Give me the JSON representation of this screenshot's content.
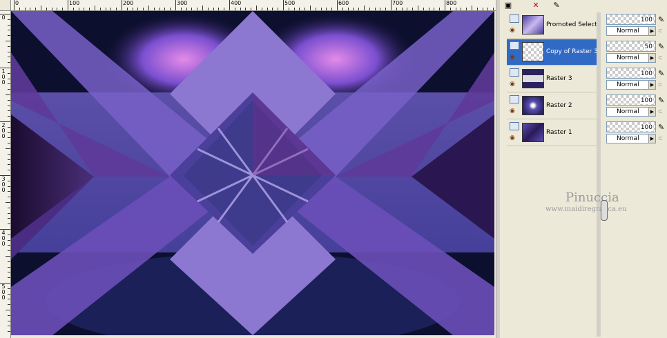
{
  "ruler": {
    "horizontal_labels": [
      "0",
      "100",
      "200",
      "300",
      "400",
      "500",
      "600",
      "700",
      "800"
    ],
    "vertical_labels": [
      "0",
      "1\n0\n0",
      "2\n0\n0",
      "3\n0\n0",
      "4\n0\n0",
      "5\n0\n0"
    ]
  },
  "toolbar": {
    "icons": [
      "new-layer-icon",
      "delete-layer-icon",
      "edit-icon"
    ]
  },
  "layers": [
    {
      "name": "Promoted Selection",
      "selected": false,
      "opacity": "100",
      "blend": "Normal"
    },
    {
      "name": "Copy of Raster 3",
      "selected": true,
      "opacity": "50",
      "blend": "Normal"
    },
    {
      "name": "Raster 3",
      "selected": false,
      "opacity": "100",
      "blend": "Normal"
    },
    {
      "name": "Raster 2",
      "selected": false,
      "opacity": "100",
      "blend": "Normal"
    },
    {
      "name": "Raster 1",
      "selected": false,
      "opacity": "100",
      "blend": "Normal"
    }
  ],
  "watermark": {
    "line1": "Pinuccia",
    "line2": "www.maidiregrafica.eu"
  },
  "colors": {
    "selection": "#316ac5",
    "panel": "#ece9d8",
    "canvas_purple": "#6a4fb0"
  }
}
